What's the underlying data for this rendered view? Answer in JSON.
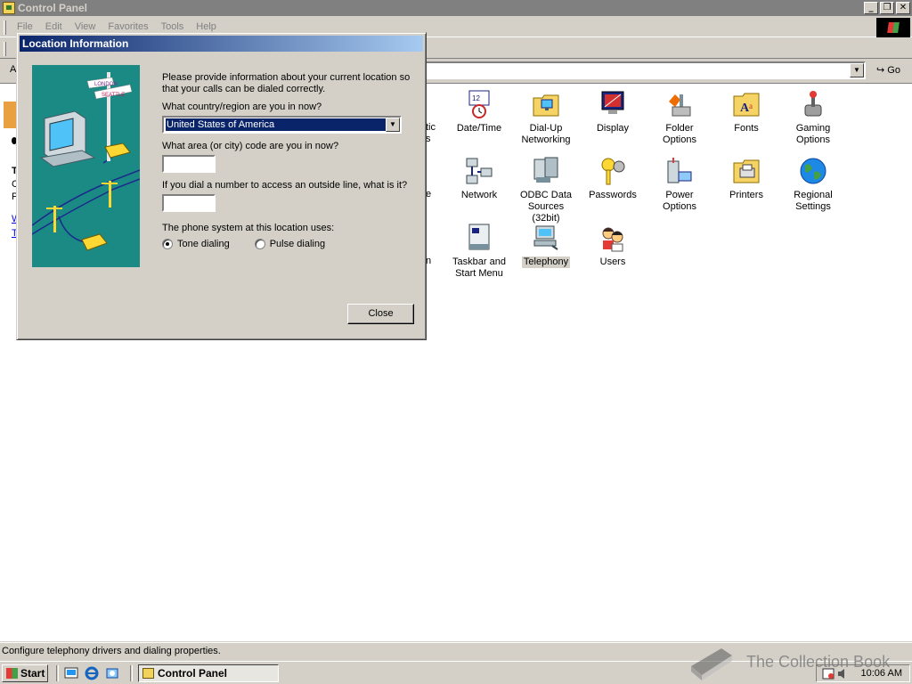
{
  "window": {
    "title": "Control Panel",
    "menus": [
      "File",
      "Edit",
      "View",
      "Favorites",
      "Tools",
      "Help"
    ],
    "address_label": "A",
    "go_label": "Go"
  },
  "control_panel": {
    "items": [
      {
        "label": "Date/Time",
        "icon": "date-time-icon"
      },
      {
        "label": "Dial-Up Networking",
        "icon": "dialup-networking-icon"
      },
      {
        "label": "Display",
        "icon": "display-icon"
      },
      {
        "label": "Folder Options",
        "icon": "folder-options-icon"
      },
      {
        "label": "Fonts",
        "icon": "fonts-icon"
      },
      {
        "label": "Gaming Options",
        "icon": "gaming-options-icon"
      },
      {
        "label": "Network",
        "icon": "network-icon"
      },
      {
        "label": "ODBC Data Sources (32bit)",
        "icon": "odbc-icon"
      },
      {
        "label": "Passwords",
        "icon": "passwords-icon"
      },
      {
        "label": "Power Options",
        "icon": "power-options-icon"
      },
      {
        "label": "Printers",
        "icon": "printers-icon"
      },
      {
        "label": "Regional Settings",
        "icon": "regional-settings-icon"
      },
      {
        "label": "Taskbar and Start Menu",
        "icon": "taskbar-icon"
      },
      {
        "label": "Telephony",
        "icon": "telephony-icon",
        "selected": true
      },
      {
        "label": "Users",
        "icon": "users-icon"
      }
    ],
    "partial_labels": [
      "tic",
      "s",
      "e",
      "n"
    ]
  },
  "dialog": {
    "title": "Location Information",
    "intro": "Please provide information about your current location so that your calls can be dialed correctly.",
    "country_question": "What country/region are you in now?",
    "country_value": "United States of America",
    "area_question": "What area (or city) code are you in now?",
    "area_value": "",
    "outside_question": "If you dial a number to access an outside line, what is it?",
    "outside_value": "",
    "phone_system_label": "The phone system at this location uses:",
    "tone_label": "Tone dialing",
    "pulse_label": "Pulse dialing",
    "selected_dialing": "tone",
    "close_label": "Close",
    "art_signs": [
      "LONDON",
      "SEATTLE"
    ]
  },
  "status": {
    "text": "Configure telephony drivers and dialing properties."
  },
  "taskbar": {
    "start_label": "Start",
    "task_label": "Control Panel",
    "clock": "10:06 AM"
  },
  "watermark": {
    "text": "The Collection Book"
  }
}
